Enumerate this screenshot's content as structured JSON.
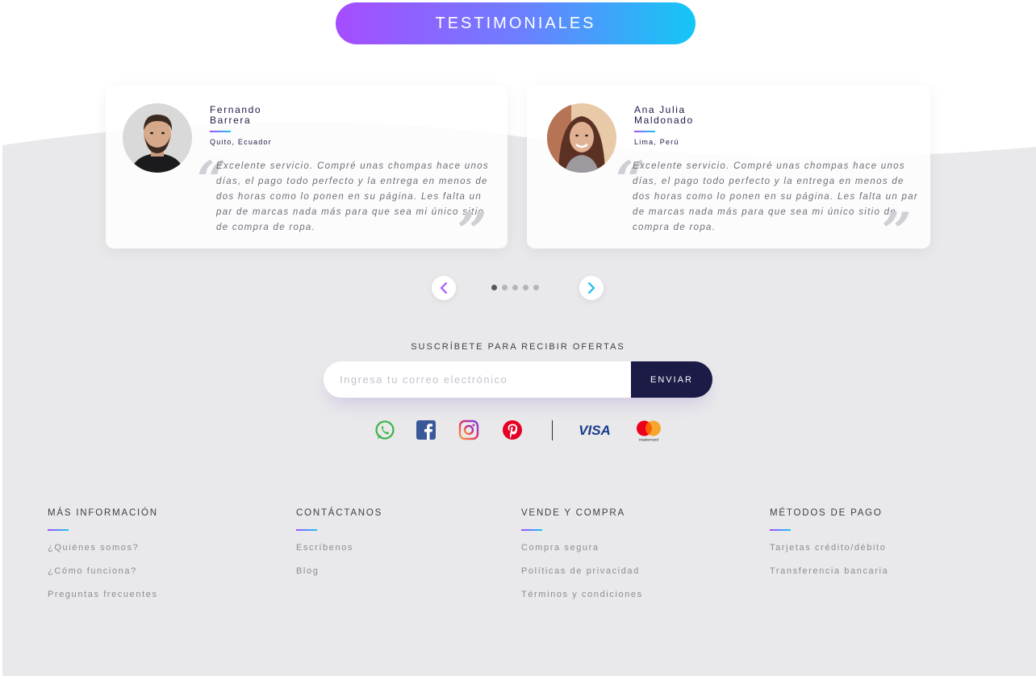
{
  "section_title": "TESTIMONIALES",
  "testimonials": [
    {
      "name": "Fernando Barrera",
      "location": "Quito, Ecuador",
      "quote": "Excelente servicio. Compré unas chompas hace unos días, el pago todo perfecto y la entrega en menos de dos horas como lo ponen en su página. Les falta un par de marcas nada más para que sea mi único sitio de compra de ropa."
    },
    {
      "name": "Ana Julia Maldonado",
      "location": "Lima, Perú",
      "quote": "Excelente servicio. Compré unas chompas hace unos días, el pago todo perfecto y la entrega en menos de dos horas como lo ponen en su página. Les falta un par de marcas nada más para que sea mi único sitio de compra de ropa."
    }
  ],
  "carousel": {
    "dot_count": 5,
    "active_dot": 0
  },
  "subscribe": {
    "label": "SUSCRÍBETE PARA RECIBIR OFERTAS",
    "placeholder": "Ingresa tu correo electrónico",
    "button": "ENVIAR"
  },
  "social_icons": [
    "whatsapp-icon",
    "facebook-icon",
    "instagram-icon",
    "pinterest-icon"
  ],
  "payment_logos": {
    "visa": "VISA",
    "mastercard": "mastercard"
  },
  "footer": [
    {
      "heading": "MÁS INFORMACIÓN",
      "links": [
        "¿Quiénes somos?",
        "¿Cómo funciona?",
        "Preguntas frecuentes"
      ]
    },
    {
      "heading": "CONTÁCTANOS",
      "links": [
        "Escríbenos",
        "Blog"
      ]
    },
    {
      "heading": "VENDE Y COMPRA",
      "links": [
        "Compra segura",
        "Políticas de privacidad",
        "Términos y condiciones"
      ]
    },
    {
      "heading": "MÉTODOS DE PAGO",
      "links": [
        "Tarjetas crédito/débito",
        "Transferencia bancaria"
      ]
    }
  ],
  "colors": {
    "accent_purple": "#a64dff",
    "accent_cyan": "#13c7f5",
    "navy": "#1c1a47",
    "background_grey": "#e9e9eb"
  }
}
